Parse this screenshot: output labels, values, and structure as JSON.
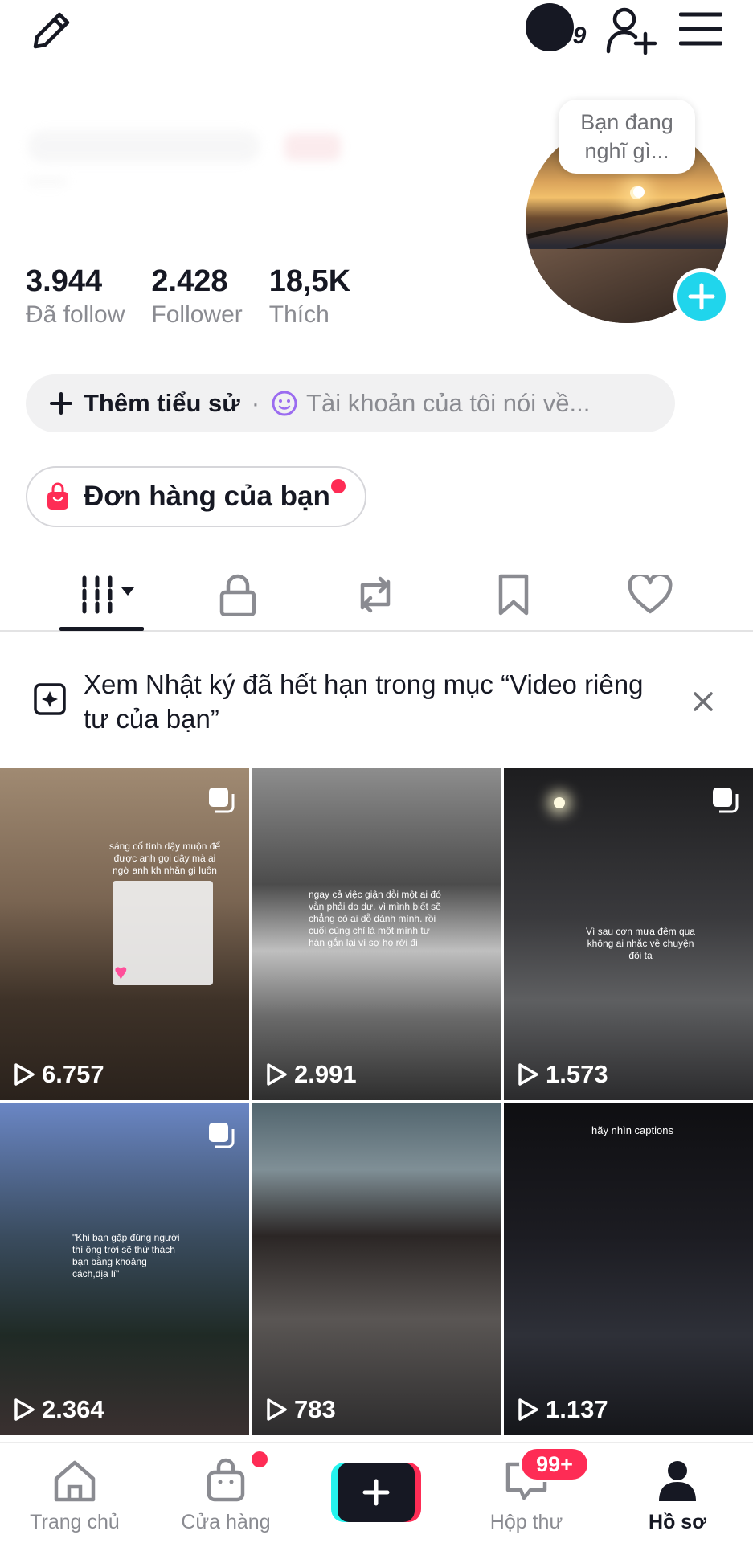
{
  "header": {
    "edit_icon": "pencil-icon",
    "dark_mode_icon": "moon-icon",
    "dark_mode_count": "99",
    "add_friend_icon": "person-add-icon",
    "menu_icon": "hamburger-icon"
  },
  "profile": {
    "thought_bubble": "Bạn đang nghĩ gì...",
    "stats": [
      {
        "value": "3.944",
        "label": "Đã follow"
      },
      {
        "value": "2.428",
        "label": "Follower"
      },
      {
        "value": "18,5K",
        "label": "Thích"
      }
    ],
    "add_bio_label": "Thêm tiểu sử",
    "separator": "·",
    "bio_hint": "Tài khoản của tôi nói về...",
    "orders_label": "Đơn hàng của bạn"
  },
  "tabs": [
    {
      "name": "videos",
      "icon": "grid-icon",
      "active": true
    },
    {
      "name": "private",
      "icon": "lock-icon"
    },
    {
      "name": "reposts",
      "icon": "repost-icon"
    },
    {
      "name": "saved",
      "icon": "bookmark-icon"
    },
    {
      "name": "liked",
      "icon": "heart-icon"
    }
  ],
  "notice": {
    "text": "Xem Nhật ký đã hết hạn trong mục “Video riêng tư của bạn”"
  },
  "videos": [
    {
      "views": "6.757",
      "caption": "sáng cố tình dậy muộn để được anh gọi dậy mà ai ngờ anh kh nhắn gì luôn",
      "multi": true
    },
    {
      "views": "2.991",
      "caption": "ngay cả việc giận dỗi một ai đó vẫn phải do dự. vì mình biết sẽ chẳng có ai dỗ dành mình. rồi cuối cùng chỉ là một mình tự hàn gắn lại vì sợ họ rời đi",
      "multi": false
    },
    {
      "views": "1.573",
      "caption": "Vì sau cơn mưa đêm qua không ai nhắc về chuyện đôi ta",
      "multi": true
    },
    {
      "views": "2.364",
      "caption": "\"Khi bạn gặp đúng người thì ông trời sẽ thử thách bạn bằng khoảng cách,địa lí\"",
      "multi": true
    },
    {
      "views": "783",
      "caption": "",
      "multi": false
    },
    {
      "views": "1.137",
      "caption": "hãy nhìn captions",
      "multi": false
    }
  ],
  "bottom_nav": {
    "items": [
      {
        "label": "Trang chủ",
        "icon": "home-icon"
      },
      {
        "label": "Cửa hàng",
        "icon": "shopping-bag-icon"
      },
      {
        "label": "",
        "icon": "plus-icon"
      },
      {
        "label": "Hộp thư",
        "icon": "inbox-icon"
      },
      {
        "label": "Hồ sơ",
        "icon": "profile-icon",
        "active": true
      }
    ],
    "inbox_badge": "99+"
  },
  "colors": {
    "accent_cyan": "#20d5ec",
    "accent_red": "#fe2c55",
    "text_primary": "#161823",
    "text_secondary": "#8a8b91"
  }
}
